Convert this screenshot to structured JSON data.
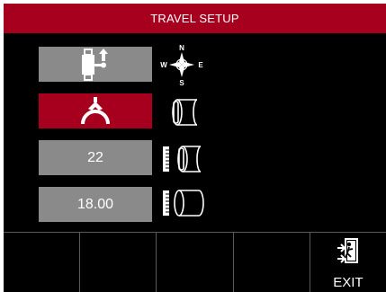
{
  "header": {
    "title": "TRAVEL SETUP"
  },
  "tiles": [
    {
      "name": "travel-direction-tile",
      "icon": "torch-up-arrow-icon",
      "value": ""
    },
    {
      "name": "mount-style-tile",
      "icon": "pipe-clamp-icon",
      "value": "",
      "active": true
    },
    {
      "name": "ring-size-tile",
      "icon": "",
      "value": "22"
    },
    {
      "name": "pipe-diameter-tile",
      "icon": "",
      "value": "18.00"
    }
  ],
  "side_icons": [
    "compass-icon",
    "pipe-ring-icon",
    "ruler-ring-icon",
    "ruler-pipe-icon"
  ],
  "compass": {
    "n": "N",
    "s": "S",
    "e": "E",
    "w": "W"
  },
  "softkeys": [
    {
      "label": ""
    },
    {
      "label": ""
    },
    {
      "label": ""
    },
    {
      "label": ""
    },
    {
      "label": "EXIT",
      "icon": "exit-icon"
    }
  ],
  "colors": {
    "accent": "#a6001e",
    "tile": "#8a8a8a",
    "background": "#000000"
  }
}
